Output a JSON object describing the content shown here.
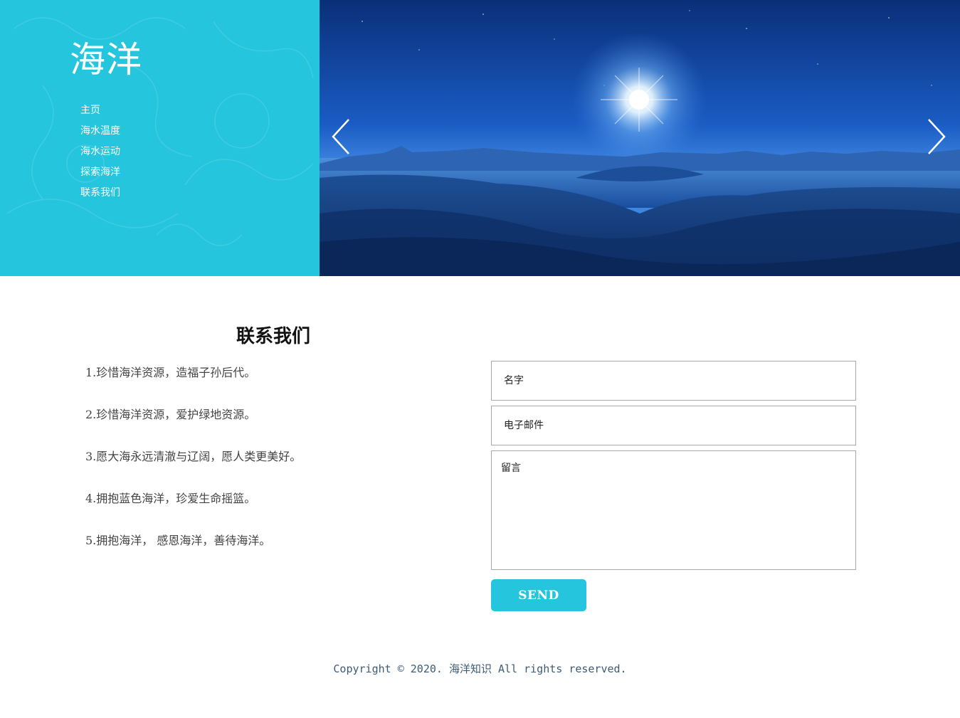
{
  "brand": {
    "logo": "海洋",
    "accent_color": "#24c5dd"
  },
  "nav": {
    "items": [
      {
        "label": "主页"
      },
      {
        "label": "海水温度"
      },
      {
        "label": "海水运动"
      },
      {
        "label": "探索海洋"
      },
      {
        "label": "联系我们"
      }
    ]
  },
  "slider": {
    "image": "night-ocean-landscape-with-bright-star",
    "prev_icon": "chevron-left-icon",
    "next_icon": "chevron-right-icon"
  },
  "contact": {
    "title": "联系我们",
    "slogans": [
      "1.珍惜海洋资源，造福子孙后代。",
      "2.珍惜海洋资源，爱护绿地资源。",
      "3.愿大海永远清澈与辽阔，愿人类更美好。",
      "4.拥抱蓝色海洋，珍爱生命摇篮。",
      "5.拥抱海洋， 感恩海洋，善待海洋。"
    ]
  },
  "form": {
    "name_placeholder": "名字",
    "name_value": "",
    "email_placeholder": "电子邮件",
    "email_value": "",
    "message_placeholder": "留言",
    "message_value": "",
    "send_label": "SEND"
  },
  "footer": {
    "copyright": "Copyright © 2020. 海洋知识 All rights reserved."
  }
}
